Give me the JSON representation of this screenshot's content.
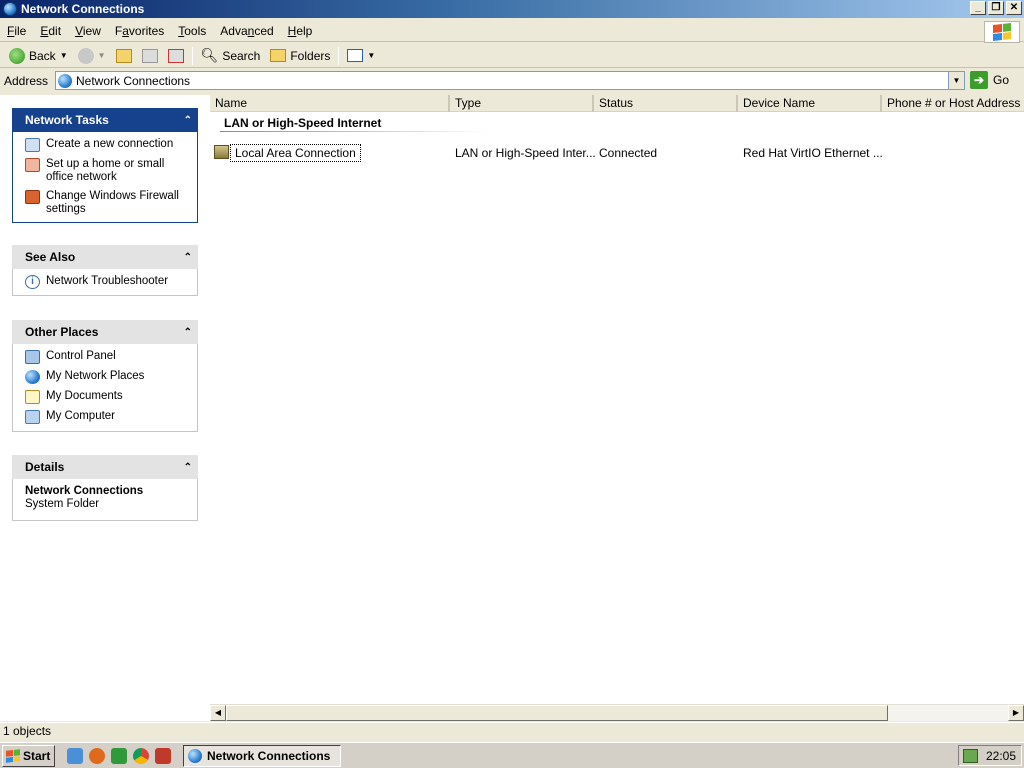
{
  "window": {
    "title": "Network Connections"
  },
  "menu": [
    {
      "label": "File",
      "key": "F",
      "rest": "ile"
    },
    {
      "label": "Edit",
      "key": "E",
      "rest": "dit"
    },
    {
      "label": "View",
      "key": "V",
      "rest": "iew"
    },
    {
      "label": "Favorites",
      "key": "",
      "rest": "Favorites",
      "ul": "a",
      "pre": "F",
      "post": "vorites"
    },
    {
      "label": "Tools",
      "key": "T",
      "rest": "ools"
    },
    {
      "label": "Advanced",
      "pre": "Adva",
      "ul": "n",
      "post": "ced"
    },
    {
      "label": "Help",
      "key": "H",
      "rest": "elp"
    }
  ],
  "toolbar": {
    "back": "Back",
    "search": "Search",
    "folders": "Folders"
  },
  "address": {
    "label": "Address",
    "value": "Network Connections",
    "go": "Go"
  },
  "panels": {
    "network_tasks": {
      "title": "Network Tasks",
      "items": [
        "Create a new connection",
        "Set up a home or small office network",
        "Change Windows Firewall settings"
      ]
    },
    "see_also": {
      "title": "See Also",
      "items": [
        "Network Troubleshooter"
      ]
    },
    "other_places": {
      "title": "Other Places",
      "items": [
        "Control Panel",
        "My Network Places",
        "My Documents",
        "My Computer"
      ]
    },
    "details": {
      "title": "Details",
      "name": "Network Connections",
      "type": "System Folder"
    }
  },
  "columns": [
    "Name",
    "Type",
    "Status",
    "Device Name",
    "Phone # or Host Address"
  ],
  "group": "LAN or High-Speed Internet",
  "rows": [
    {
      "name": "Local Area Connection",
      "type": "LAN or High-Speed Inter...",
      "status": "Connected",
      "device": "Red Hat VirtIO Ethernet ...",
      "phone": ""
    }
  ],
  "status": {
    "text": "1 objects"
  },
  "taskbar": {
    "start": "Start",
    "task": "Network Connections",
    "clock": "22:05"
  },
  "colors": {
    "title_start": "#0a246a",
    "panel_blue": "#16418c",
    "face": "#ece9d8"
  }
}
